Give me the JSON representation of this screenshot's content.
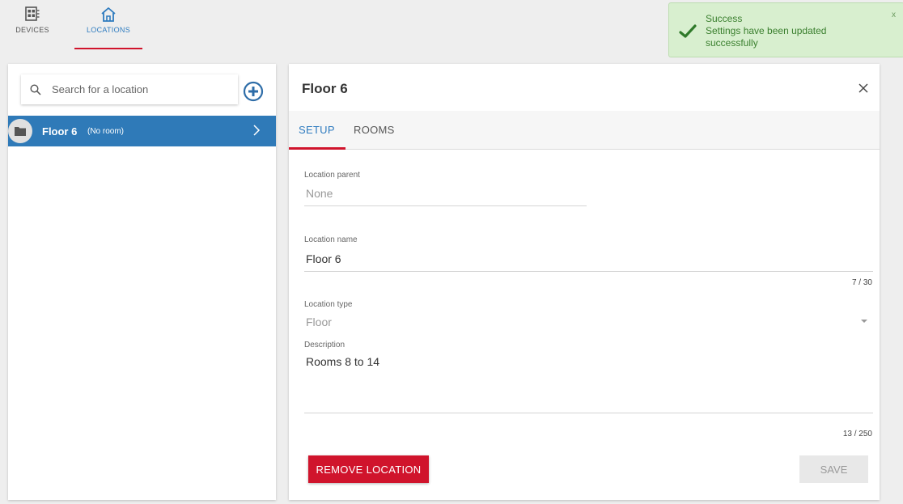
{
  "nav": {
    "devices_label": "DEVICES",
    "locations_label": "LOCATIONS",
    "active": "locations"
  },
  "toast": {
    "title": "Success",
    "message": "Settings have been updated successfully",
    "close_label": "x",
    "icon": "check-icon"
  },
  "sidebar": {
    "search_placeholder": "Search for a location",
    "search_value": "",
    "locations": [
      {
        "name": "Floor 6",
        "sub": "(No room)",
        "selected": true
      }
    ]
  },
  "detail": {
    "title": "Floor 6",
    "tabs": [
      {
        "label": "SETUP",
        "active": true
      },
      {
        "label": "ROOMS",
        "active": false
      }
    ],
    "parent": {
      "label": "Location parent",
      "value": "None"
    },
    "name": {
      "label": "Location name",
      "value": "Floor 6",
      "counter": "7 / 30"
    },
    "type": {
      "label": "Location type",
      "value": "Floor"
    },
    "description": {
      "label": "Description",
      "value": "Rooms 8 to 14",
      "counter": "13 / 250"
    },
    "remove_label": "REMOVE LOCATION",
    "save_label": "SAVE"
  },
  "colors": {
    "accent_blue": "#2e7bbf",
    "accent_red": "#d0142c",
    "success_bg": "#d8efcf",
    "success_text": "#3a7f2e"
  }
}
